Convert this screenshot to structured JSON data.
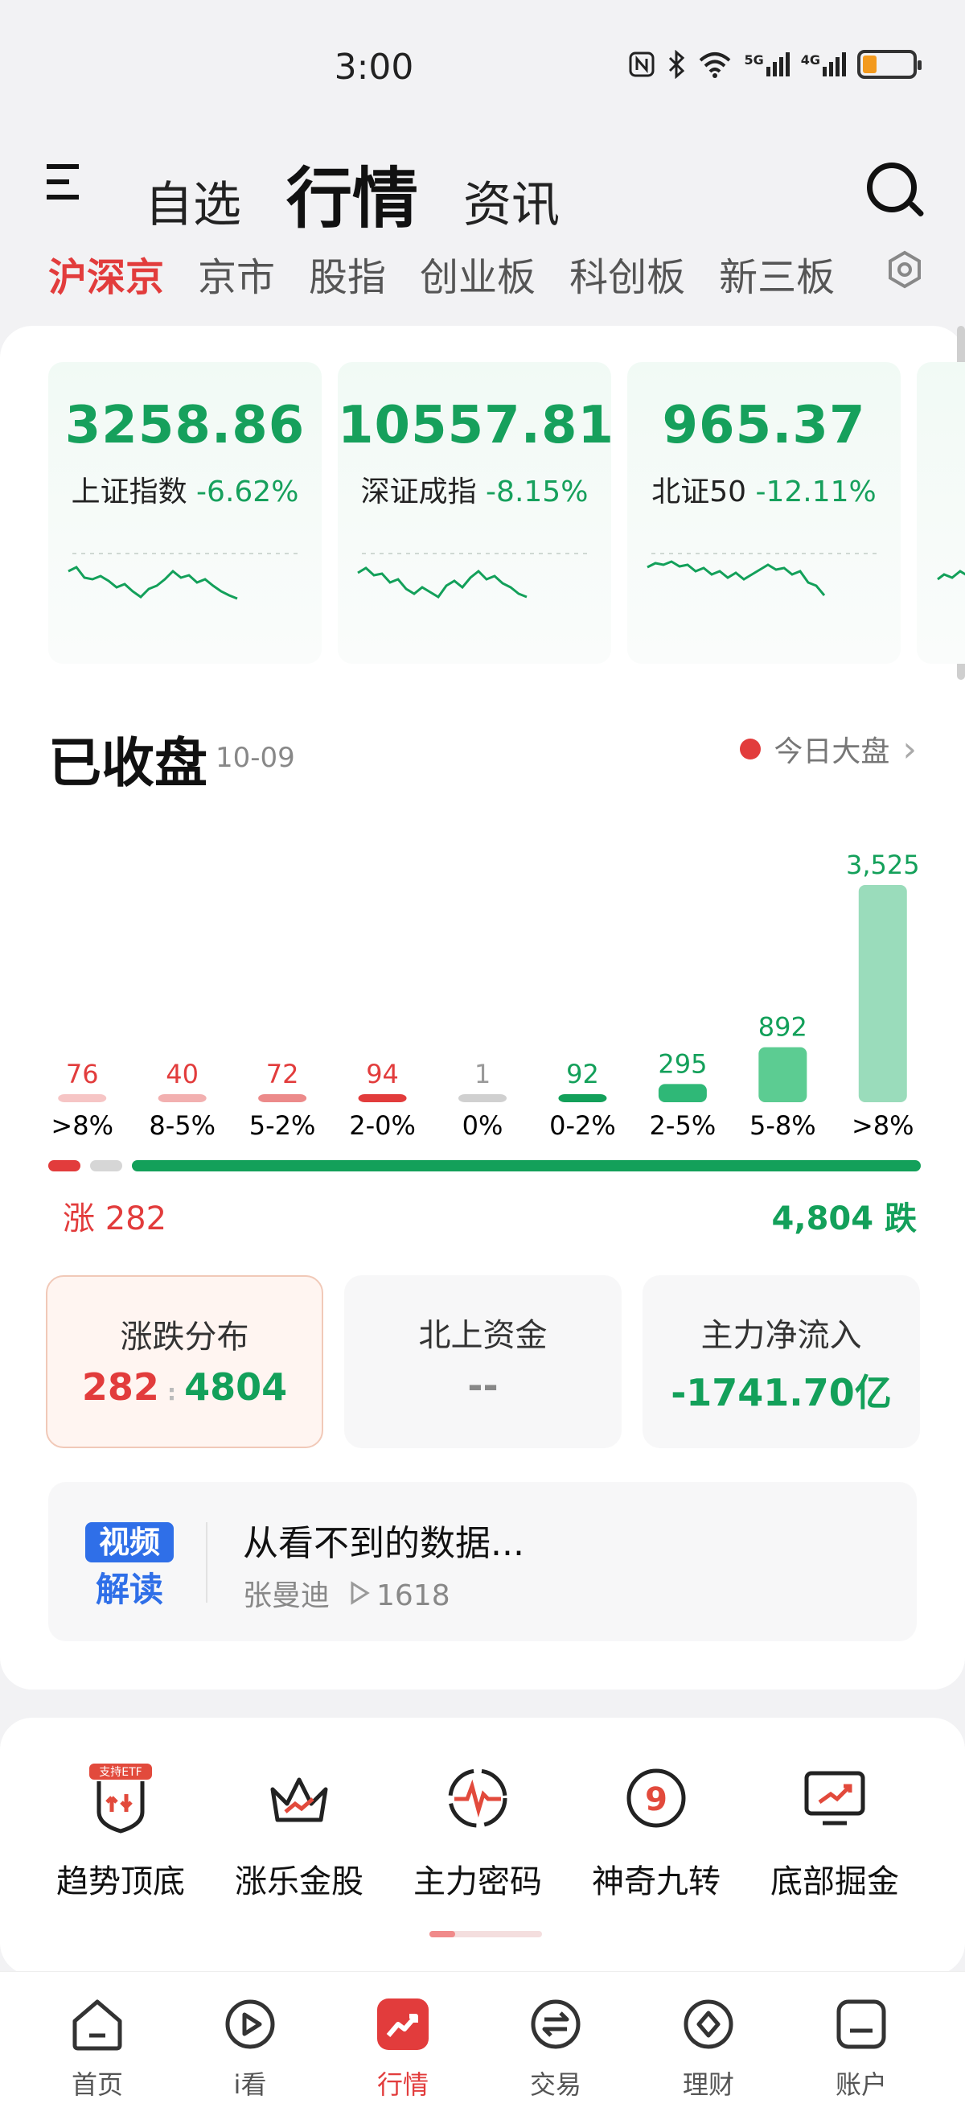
{
  "status_bar": {
    "time": "3:00",
    "icons": [
      "nfc-icon",
      "bluetooth-icon",
      "wifi-icon",
      "5g-signal-icon",
      "4g-signal-icon",
      "battery-icon"
    ],
    "net1": "5G",
    "net2": "4G"
  },
  "header": {
    "tabs": [
      {
        "label": "自选",
        "active": false
      },
      {
        "label": "行情",
        "active": true
      },
      {
        "label": "资讯",
        "active": false
      }
    ],
    "sub_tabs": [
      {
        "label": "沪深京",
        "active": true
      },
      {
        "label": "京市"
      },
      {
        "label": "股指"
      },
      {
        "label": "创业板"
      },
      {
        "label": "科创板"
      },
      {
        "label": "新三板"
      }
    ]
  },
  "indices": [
    {
      "value": "3258.86",
      "name": "上证指数",
      "change": "-6.62%"
    },
    {
      "value": "10557.81",
      "name": "深证成指",
      "change": "-8.15%"
    },
    {
      "value": "965.37",
      "name": "北证50",
      "change": "-12.11%"
    }
  ],
  "market": {
    "title": "已收盘",
    "date": "10-09",
    "today_link": "今日大盘"
  },
  "chart_data": {
    "type": "bar",
    "categories": [
      ">8%",
      "8-5%",
      "5-2%",
      "2-0%",
      "0%",
      "0-2%",
      "2-5%",
      "5-8%",
      ">8%"
    ],
    "values": [
      76,
      40,
      72,
      94,
      1,
      92,
      295,
      892,
      3525
    ],
    "value_labels": [
      "76",
      "40",
      "72",
      "94",
      "1",
      "92",
      "295",
      "892",
      "3,525"
    ],
    "colors": [
      "#f6c5c5",
      "#f2b0b0",
      "#ec8a8a",
      "#e23c3c",
      "#d0d0d0",
      "#13a05a",
      "#2fb877",
      "#5ccc92",
      "#9adcbb"
    ],
    "label_colors": [
      "#e23c3c",
      "#e23c3c",
      "#e23c3c",
      "#e23c3c",
      "#999999",
      "#13a05a",
      "#13a05a",
      "#13a05a",
      "#13a05a"
    ]
  },
  "ratio": {
    "rise": 282,
    "flat": 1,
    "fall": 4804,
    "rise_label": "涨 282",
    "fall_label": "4,804 跌"
  },
  "stats": {
    "dist": {
      "title": "涨跌分布",
      "rise": "282",
      "fall": "4804"
    },
    "north": {
      "title": "北上资金",
      "value": "--"
    },
    "flow": {
      "title": "主力净流入",
      "value": "-1741.70亿"
    }
  },
  "video": {
    "badge_top": "视频",
    "badge_bottom": "解读",
    "title": "从看不到的数据...",
    "author": "张曼迪",
    "views": "1618"
  },
  "tools": [
    {
      "label": "趋势顶底",
      "icon": "trend-top-bottom-icon",
      "tag": "支持ETF"
    },
    {
      "label": "涨乐金股",
      "icon": "crown-chart-icon"
    },
    {
      "label": "主力密码",
      "icon": "pulse-ring-icon"
    },
    {
      "label": "神奇九转",
      "icon": "nine-circle-icon"
    },
    {
      "label": "底部掘金",
      "icon": "monitor-trend-icon"
    }
  ],
  "nav": [
    {
      "label": "首页",
      "icon": "home-icon"
    },
    {
      "label": "i看",
      "icon": "play-icon"
    },
    {
      "label": "行情",
      "icon": "market-icon",
      "active": true
    },
    {
      "label": "交易",
      "icon": "trade-icon"
    },
    {
      "label": "理财",
      "icon": "finance-icon"
    },
    {
      "label": "账户",
      "icon": "account-icon"
    }
  ],
  "colors": {
    "up": "#e23c3c",
    "down": "#13a05a",
    "accent": "#e23c3c"
  }
}
